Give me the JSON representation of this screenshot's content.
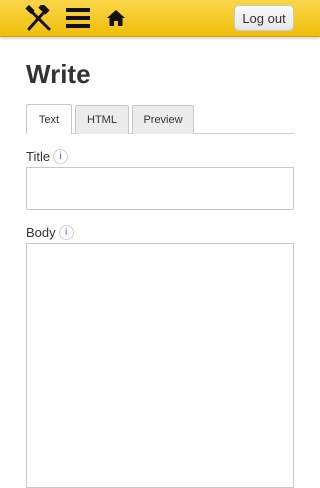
{
  "topbar": {
    "tools_icon": "tools-icon",
    "menu_icon": "hamburger-menu-icon",
    "home_icon": "home-icon",
    "logout_label": "Log out",
    "bar_color": "#f5c81f"
  },
  "page": {
    "title": "Write"
  },
  "tabs": [
    {
      "label": "Text",
      "active": true
    },
    {
      "label": "HTML",
      "active": false
    },
    {
      "label": "Preview",
      "active": false
    }
  ],
  "form": {
    "title_label": "Title",
    "title_info": "i",
    "title_value": "",
    "body_label": "Body",
    "body_info": "i",
    "body_value": ""
  }
}
